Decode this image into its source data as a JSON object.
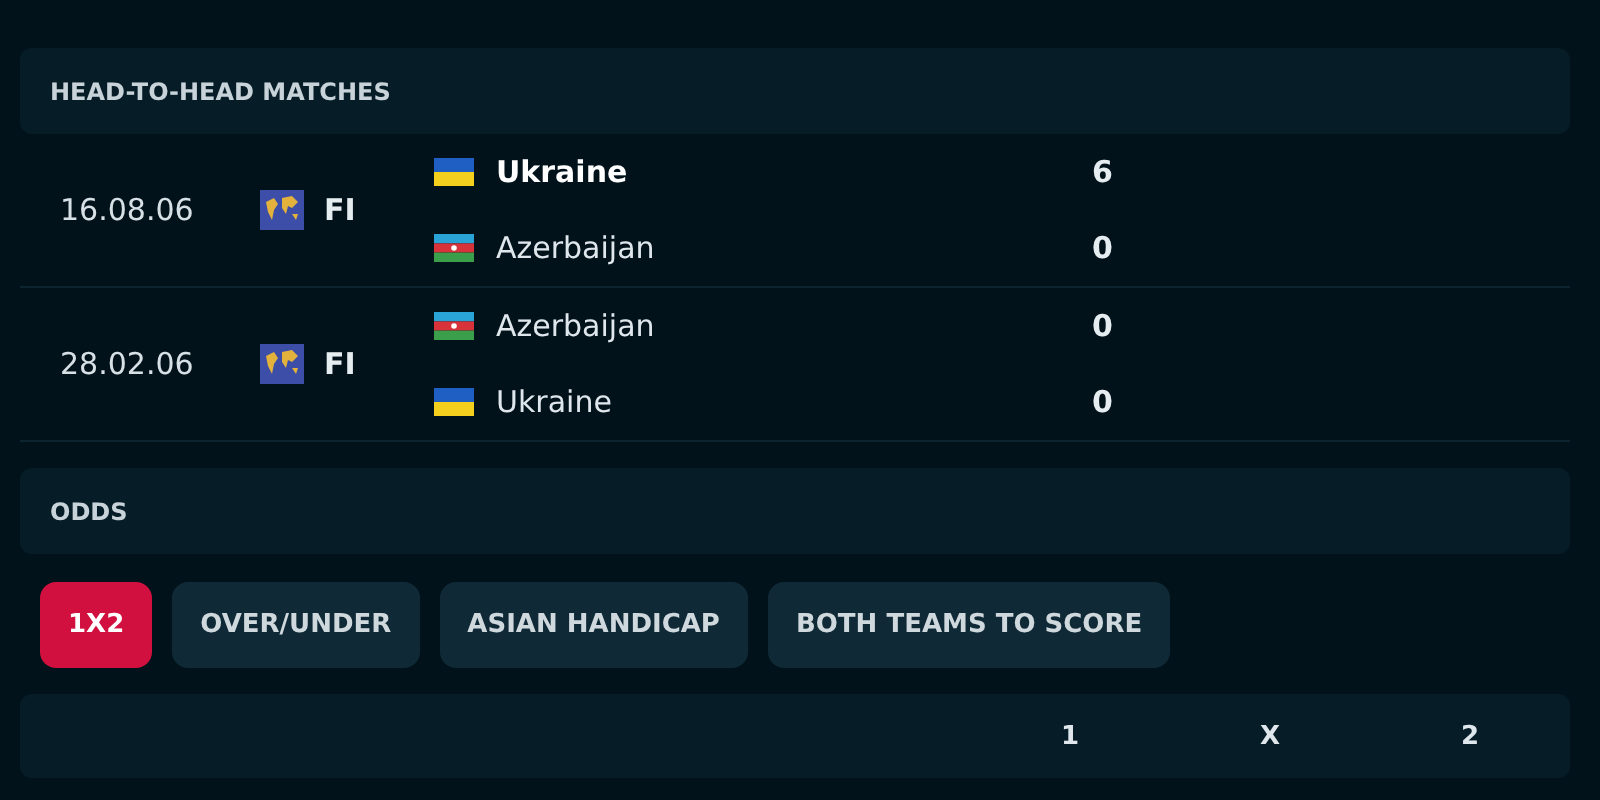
{
  "h2h": {
    "title": "HEAD-TO-HEAD MATCHES",
    "matches": [
      {
        "date": "16.08.06",
        "competition": "FI",
        "teams": [
          {
            "name": "Ukraine",
            "kind": "ukraine",
            "score": "6",
            "winner": true
          },
          {
            "name": "Azerbaijan",
            "kind": "azerbaijan",
            "score": "0",
            "winner": false
          }
        ]
      },
      {
        "date": "28.02.06",
        "competition": "FI",
        "teams": [
          {
            "name": "Azerbaijan",
            "kind": "azerbaijan",
            "score": "0",
            "winner": false
          },
          {
            "name": "Ukraine",
            "kind": "ukraine",
            "score": "0",
            "winner": false
          }
        ]
      }
    ]
  },
  "odds": {
    "title": "ODDS",
    "tabs": [
      {
        "label": "1X2",
        "selected": true
      },
      {
        "label": "OVER/UNDER",
        "selected": false
      },
      {
        "label": "ASIAN HANDICAP",
        "selected": false
      },
      {
        "label": "BOTH TEAMS TO SCORE",
        "selected": false
      }
    ],
    "columns": [
      "1",
      "X",
      "2"
    ]
  }
}
